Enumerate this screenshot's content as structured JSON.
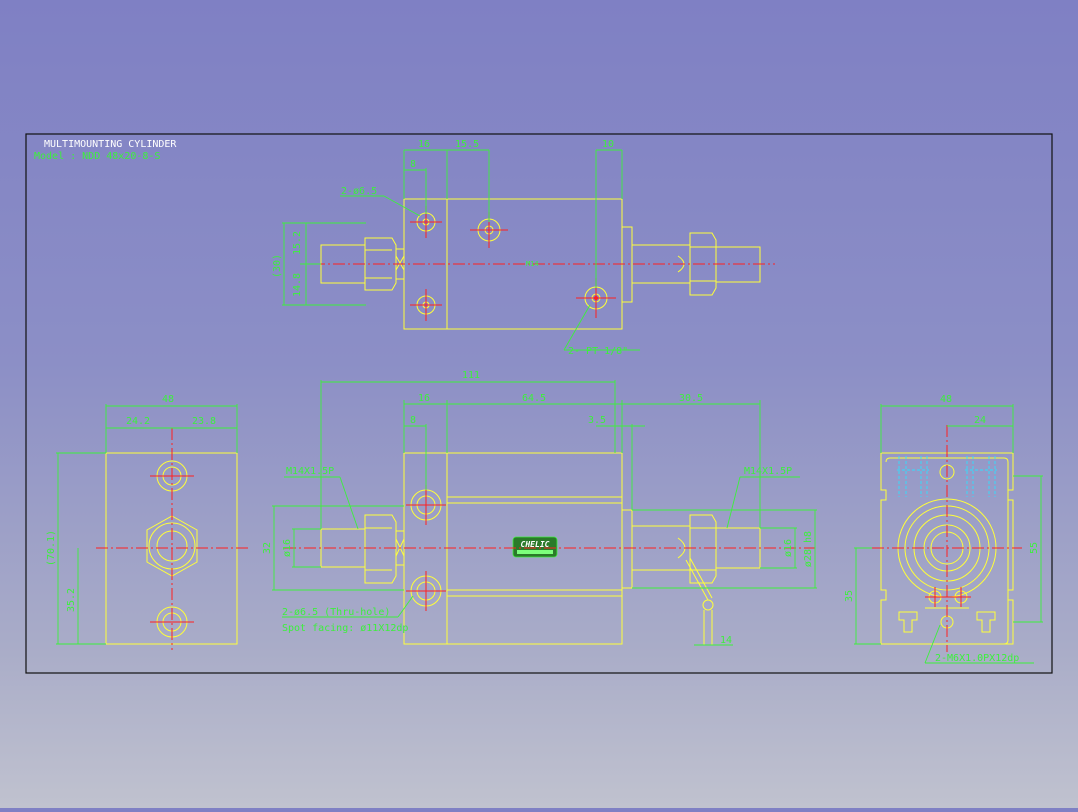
{
  "title_block": {
    "title": "MULTIMOUNTING CYLINDER",
    "model": "Model : NDD 48x20-8-S"
  },
  "top_view": {
    "dim_16": "16",
    "dim_15_5": "15.5",
    "dim_10": "10",
    "dim_8": "8",
    "hole_note": "2-ø6.5",
    "dim_30": "(30)",
    "dim_15_2": "15.2",
    "dim_14_8": "14.8",
    "port_note": "2- PT 1/8\"",
    "center_mark": "M14"
  },
  "side_view": {
    "dim_111": "111",
    "dim_16": "16",
    "dim_64_5": "64.5",
    "dim_30_5": "30.5",
    "dim_8": "8",
    "dim_3_5": "3.5",
    "thread_left": "M14X1.5P",
    "thread_right": "M14X1.5P",
    "dim_32": "32",
    "dim_16_left": "ø16",
    "dim_16_right": "ø16",
    "dim_28": "ø28 h8",
    "hole_note": "2-ø6.5 (Thru-hole)",
    "spot_note": "Spot facing: ø11X12dp",
    "dim_14": "14",
    "brand": "CHELIC"
  },
  "left_view": {
    "dim_48": "48",
    "dim_24_2": "24.2",
    "dim_23_8": "23.8",
    "dim_70_1": "(70.1)",
    "dim_35_2": "35.2"
  },
  "right_view": {
    "dim_48": "48",
    "dim_24": "24",
    "dim_55": "55",
    "dim_35": "35",
    "tap_note": "2-M6X1.0PX12dp"
  }
}
